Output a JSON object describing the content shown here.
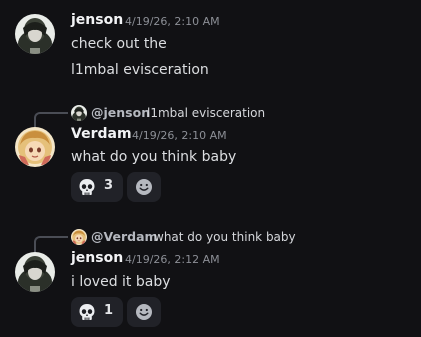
{
  "messages": [
    {
      "author": "jenson",
      "timestamp": "4/19/26, 2:10 AM",
      "lines": [
        "check out the",
        "l1mbal evisceration"
      ]
    },
    {
      "reply_to": {
        "name": "@jenson",
        "snippet": "l1mbal evisceration"
      },
      "author": "Verdam",
      "timestamp": "4/19/26, 2:10 AM",
      "lines": [
        "what do you think baby"
      ],
      "reaction": {
        "emoji": "skull-icon",
        "count": "3"
      }
    },
    {
      "reply_to": {
        "name": "@Verdam",
        "snippet": "what do you think baby"
      },
      "author": "jenson",
      "timestamp": "4/19/26, 2:12 AM",
      "lines": [
        "i loved it baby"
      ],
      "reaction": {
        "emoji": "skull-icon",
        "count": "1"
      }
    }
  ],
  "colors": {
    "background": "#111114",
    "author": "#f2f3f5",
    "timestamp": "#8c8f96",
    "message_text": "#dcdee1",
    "reaction_bg": "#212228"
  }
}
